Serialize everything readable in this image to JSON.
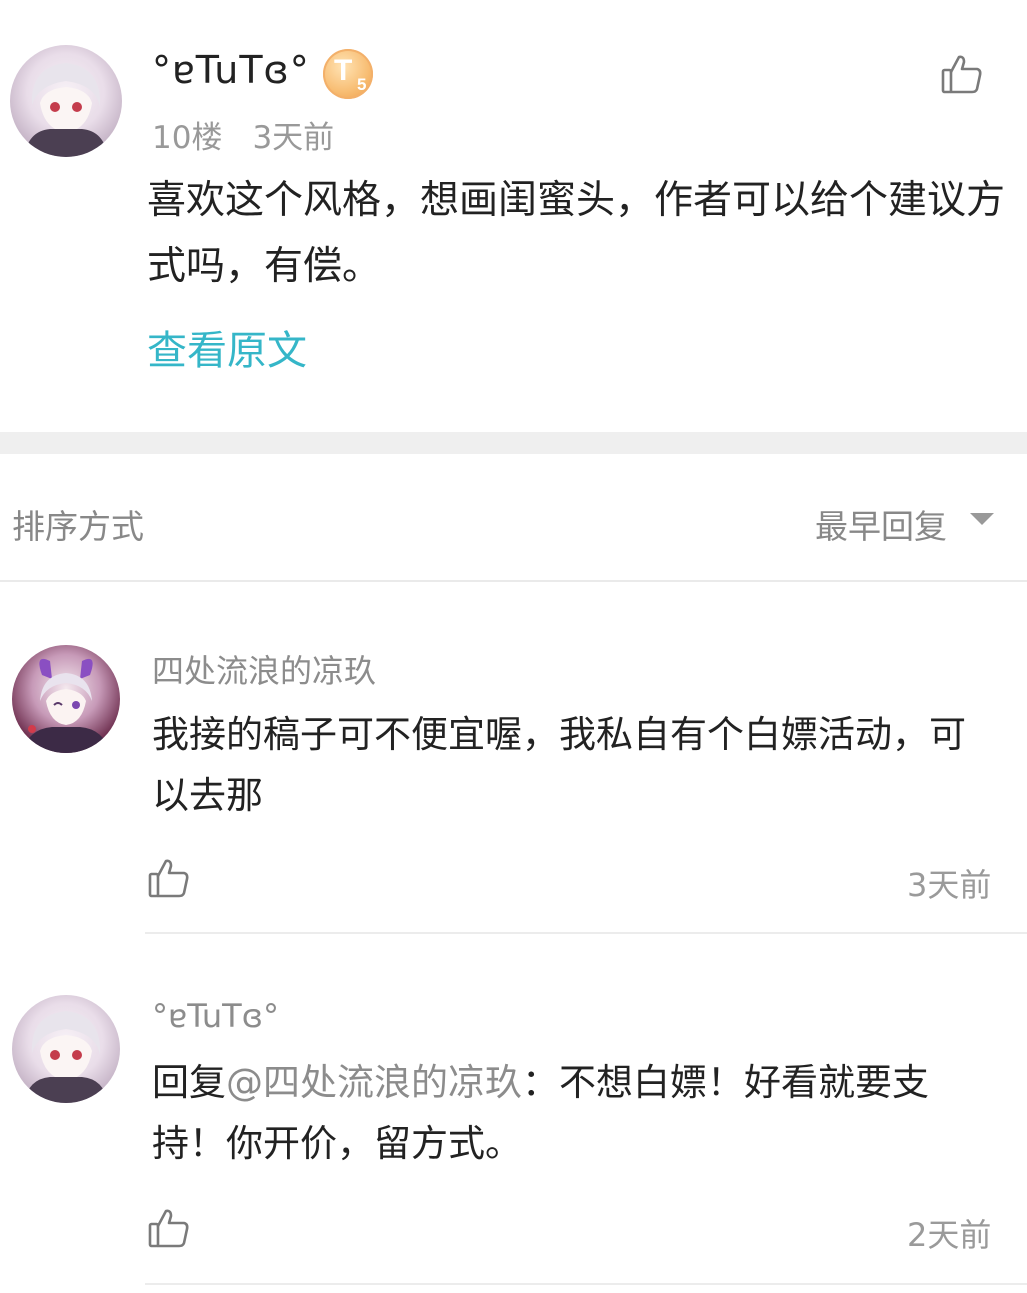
{
  "post": {
    "author": "°ɐTuTɞ°",
    "level_badge": {
      "letter": "T",
      "number": "5",
      "color": "#f4b061"
    },
    "floor": "10楼",
    "time": "3天前",
    "content": "喜欢这个风格，想画闺蜜头，作者可以给个建议方式吗，有偿。",
    "view_original": "查看原文",
    "like_icon": "thumbs-up-icon"
  },
  "sort": {
    "label": "排序方式",
    "selected": "最早回复",
    "caret_icon": "caret-down-icon"
  },
  "replies": [
    {
      "author": "四处流浪的凉玖",
      "content": "我接的稿子可不便宜喔，我私自有个白嫖活动，可以去那",
      "time": "3天前",
      "like_icon": "thumbs-up-icon"
    },
    {
      "author": "°ɐTuTɞ°",
      "reply_prefix": "回复",
      "mention": "@四处流浪的凉玖",
      "content": "：不想白嫖！好看就要支持！你开价，留方式。",
      "time": "2天前",
      "like_icon": "thumbs-up-icon"
    }
  ],
  "colors": {
    "link": "#35b6c8",
    "secondary_text": "#999999",
    "divider_band": "#efefef"
  }
}
